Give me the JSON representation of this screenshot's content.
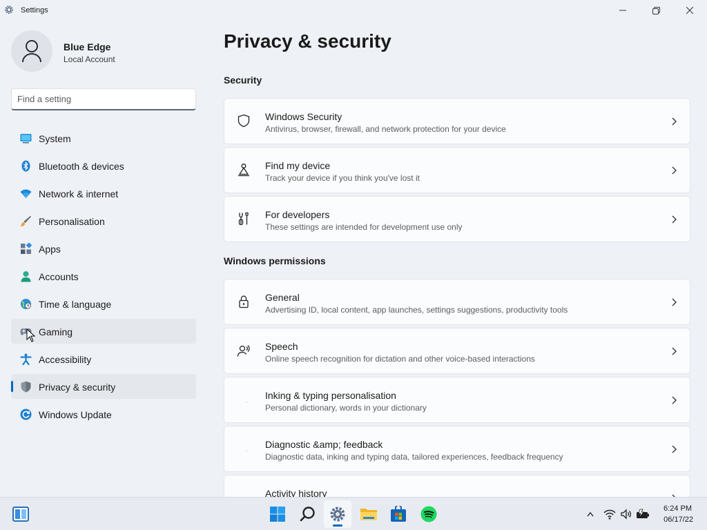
{
  "window": {
    "title": "Settings"
  },
  "profile": {
    "name": "Blue Edge",
    "account_type": "Local Account"
  },
  "search": {
    "placeholder": "Find a setting"
  },
  "nav": [
    {
      "label": "System",
      "icon": "system-icon",
      "state": ""
    },
    {
      "label": "Bluetooth & devices",
      "icon": "bluetooth-icon",
      "state": ""
    },
    {
      "label": "Network & internet",
      "icon": "wifi-icon",
      "state": ""
    },
    {
      "label": "Personalisation",
      "icon": "brush-icon",
      "state": ""
    },
    {
      "label": "Apps",
      "icon": "apps-icon",
      "state": ""
    },
    {
      "label": "Accounts",
      "icon": "accounts-icon",
      "state": ""
    },
    {
      "label": "Time & language",
      "icon": "globe-clock-icon",
      "state": ""
    },
    {
      "label": "Gaming",
      "icon": "gamepad-icon",
      "state": "hover"
    },
    {
      "label": "Accessibility",
      "icon": "accessibility-icon",
      "state": ""
    },
    {
      "label": "Privacy & security",
      "icon": "shield-icon",
      "state": "active"
    },
    {
      "label": "Windows Update",
      "icon": "update-icon",
      "state": ""
    }
  ],
  "main": {
    "title": "Privacy & security",
    "sections": [
      {
        "title": "Security",
        "cards": [
          {
            "title": "Windows Security",
            "desc": "Antivirus, browser, firewall, and network protection for your device",
            "icon": "shield-outline-icon"
          },
          {
            "title": "Find my device",
            "desc": "Track your device if you think you've lost it",
            "icon": "find-device-icon"
          },
          {
            "title": "For developers",
            "desc": "These settings are intended for development use only",
            "icon": "developer-tools-icon"
          }
        ]
      },
      {
        "title": "Windows permissions",
        "cards": [
          {
            "title": "General",
            "desc": "Advertising ID, local content, app launches, settings suggestions, productivity tools",
            "icon": "lock-icon"
          },
          {
            "title": "Speech",
            "desc": "Online speech recognition for dictation and other voice-based interactions",
            "icon": "speech-icon"
          },
          {
            "title": "Inking & typing personalisation",
            "desc": "Personal dictionary, words in your dictionary",
            "icon": "blank-icon"
          },
          {
            "title": "Diagnostic &amp; feedback",
            "desc": "Diagnostic data, inking and typing data, tailored experiences, feedback frequency",
            "icon": "blank-icon"
          },
          {
            "title": "Activity history",
            "desc": "",
            "icon": "blank-icon"
          }
        ]
      }
    ]
  },
  "taskbar": {
    "apps": [
      "widgets-icon",
      "start-icon",
      "search-icon",
      "settings-icon",
      "file-explorer-icon",
      "store-icon",
      "spotify-icon"
    ],
    "time": "6:24 PM",
    "date": "06/17/22"
  },
  "colors": {
    "accent": "#0067c0",
    "background": "#eef1f6",
    "card": "#fbfcfd"
  }
}
